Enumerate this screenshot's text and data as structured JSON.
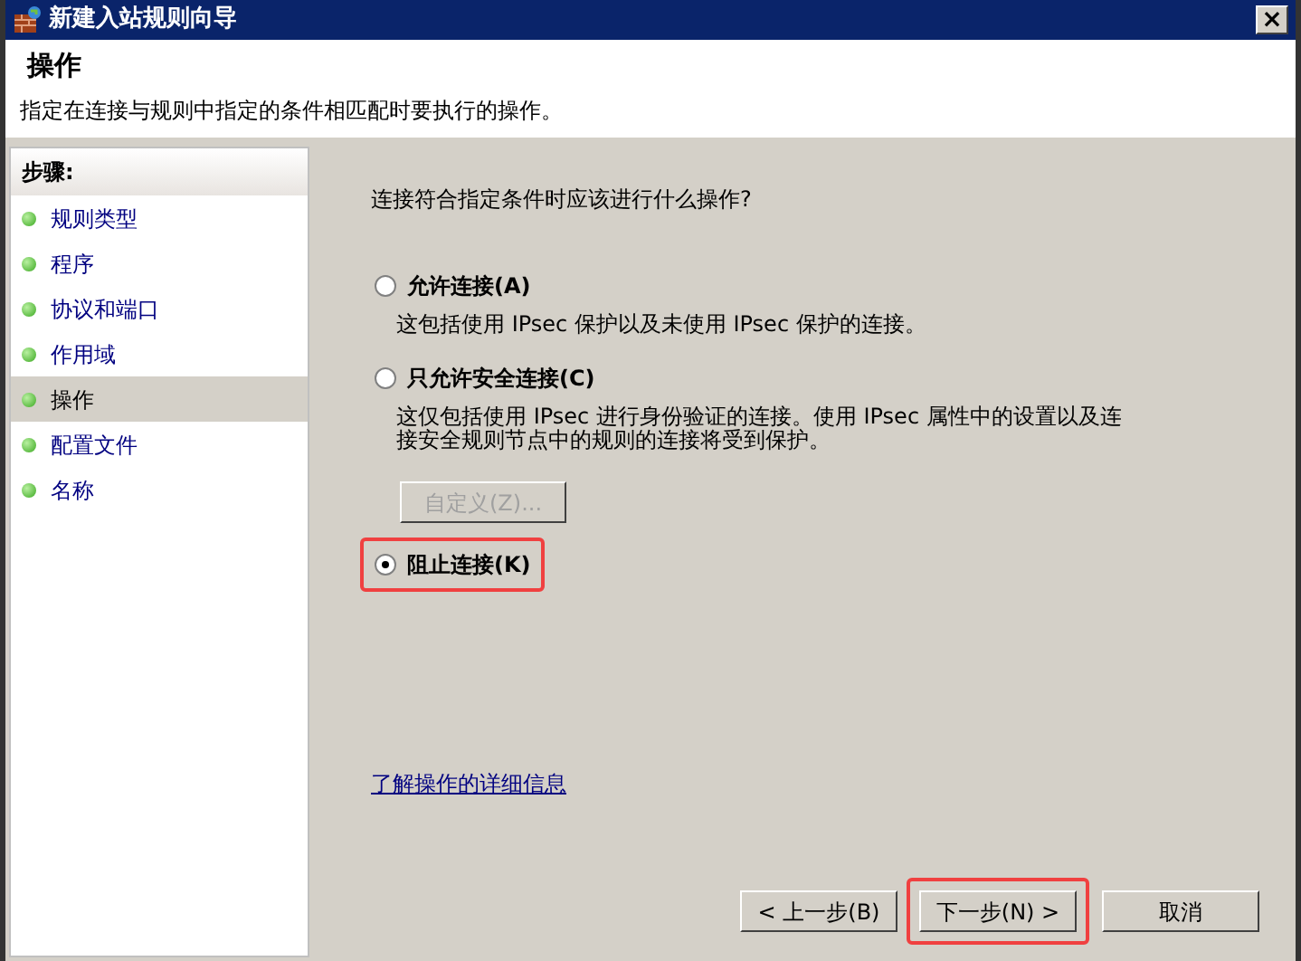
{
  "window": {
    "title": "新建入站规则向导",
    "close": "×"
  },
  "header": {
    "title": "操作",
    "description": "指定在连接与规则中指定的条件相匹配时要执行的操作。"
  },
  "steps": {
    "title": "步骤:",
    "items": [
      {
        "label": "规则类型",
        "selected": false
      },
      {
        "label": "程序",
        "selected": false
      },
      {
        "label": "协议和端口",
        "selected": false
      },
      {
        "label": "作用域",
        "selected": false
      },
      {
        "label": "操作",
        "selected": true
      },
      {
        "label": "配置文件",
        "selected": false
      },
      {
        "label": "名称",
        "selected": false
      }
    ]
  },
  "question": "连接符合指定条件时应该进行什么操作?",
  "options": [
    {
      "label": "允许连接(A)",
      "description": "这包括使用 IPsec 保护以及未使用 IPsec 保护的连接。",
      "selected": false,
      "highlighted": false
    },
    {
      "label": "只允许安全连接(C)",
      "description": "这仅包括使用 IPsec 进行身份验证的连接。使用 IPsec 属性中的设置以及连接安全规则节点中的规则的连接将受到保护。",
      "selected": false,
      "highlighted": false,
      "button": {
        "label": "自定义(Z)...",
        "disabled": true
      }
    },
    {
      "label": "阻止连接(K)",
      "selected": true,
      "highlighted": true
    }
  ],
  "help_link": "了解操作的详细信息",
  "buttons": [
    {
      "label": "< 上一步(B)",
      "highlighted": false
    },
    {
      "label": "下一步(N) >",
      "highlighted": true
    },
    {
      "label": "取消",
      "highlighted": false
    }
  ]
}
